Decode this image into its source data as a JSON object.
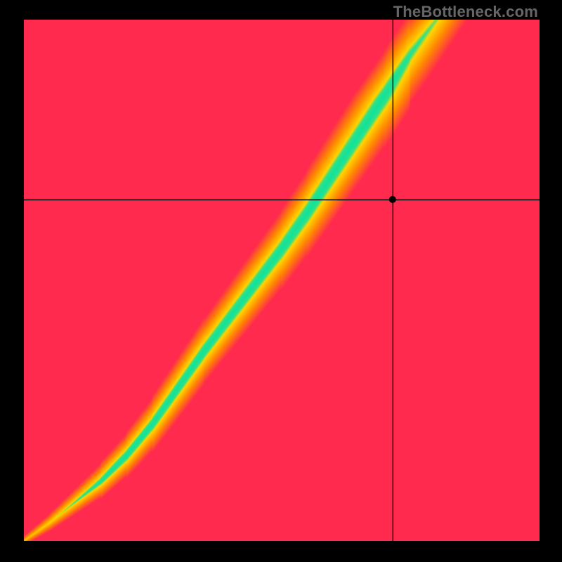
{
  "watermark": "TheBottleneck.com",
  "chart_data": {
    "type": "heatmap",
    "title": "",
    "xlabel": "",
    "ylabel": "",
    "xlim": [
      0,
      1
    ],
    "ylim": [
      0,
      1
    ],
    "crosshair": {
      "x": 0.715,
      "y": 0.655
    },
    "marker": {
      "x": 0.715,
      "y": 0.655
    },
    "ridge_points": [
      {
        "x": 0.0,
        "y": 0.0
      },
      {
        "x": 0.05,
        "y": 0.035
      },
      {
        "x": 0.1,
        "y": 0.075
      },
      {
        "x": 0.15,
        "y": 0.115
      },
      {
        "x": 0.2,
        "y": 0.165
      },
      {
        "x": 0.25,
        "y": 0.225
      },
      {
        "x": 0.3,
        "y": 0.295
      },
      {
        "x": 0.35,
        "y": 0.365
      },
      {
        "x": 0.4,
        "y": 0.43
      },
      {
        "x": 0.45,
        "y": 0.495
      },
      {
        "x": 0.5,
        "y": 0.56
      },
      {
        "x": 0.55,
        "y": 0.63
      },
      {
        "x": 0.6,
        "y": 0.705
      },
      {
        "x": 0.65,
        "y": 0.78
      },
      {
        "x": 0.7,
        "y": 0.855
      },
      {
        "x": 0.75,
        "y": 0.935
      },
      {
        "x": 0.8,
        "y": 1.0
      }
    ],
    "band_half_width": 0.045,
    "colors": {
      "optimal": "#14e39a",
      "mid": "#ffd400",
      "warn": "#ff8a00",
      "bad": "#ff2a4d"
    },
    "description": "Green diagonal band indicates balanced CPU/GPU pairing; red regions indicate bottleneck. Crosshair marks the queried configuration."
  }
}
